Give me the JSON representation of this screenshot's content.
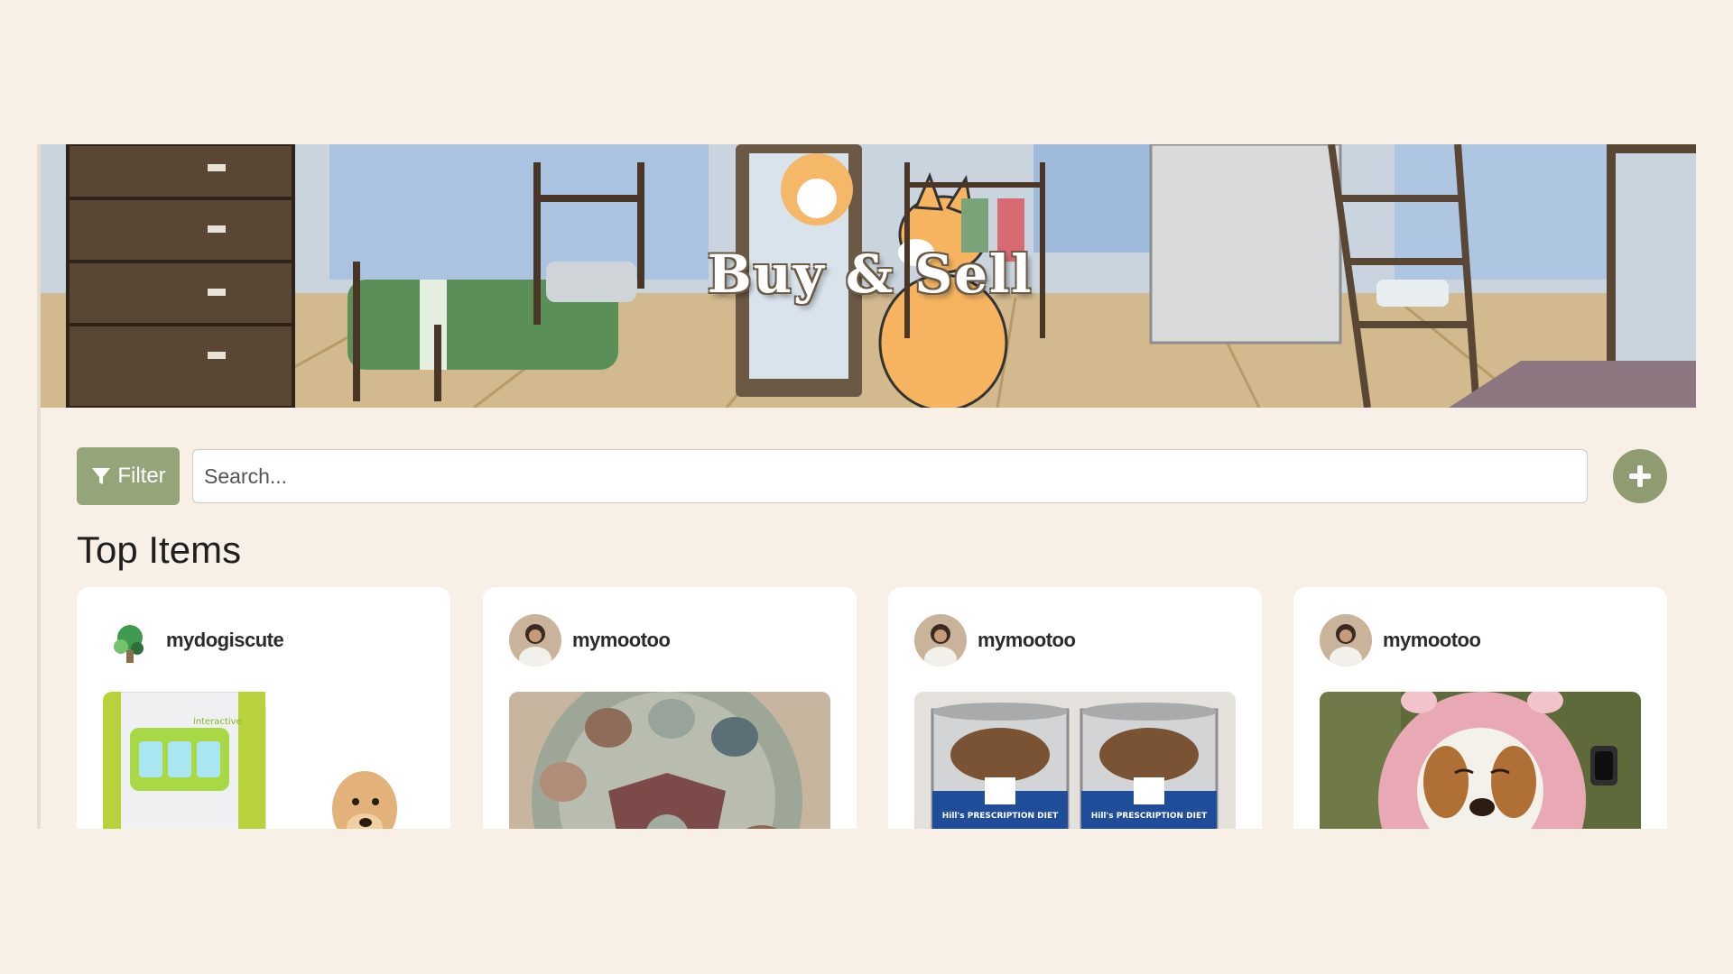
{
  "banner": {
    "title": "Buy & Sell"
  },
  "toolbar": {
    "filter_label": "Filter",
    "search_placeholder": "Search...",
    "search_value": "",
    "add_icon": "plus-circle-icon"
  },
  "section": {
    "title": "Top Items"
  },
  "items": [
    {
      "username": "mydogiscute",
      "image": "interactive-dog-toy-with-labrador",
      "image_text": "interactive"
    },
    {
      "username": "mymootoo",
      "image": "puzzle-feeder-bowl"
    },
    {
      "username": "mymootoo",
      "image": "hills-prescription-diet-cans",
      "image_text": "Hill's PRESCRIPTION DIET"
    },
    {
      "username": "mymootoo",
      "image": "beagle-in-pink-hoodie"
    }
  ],
  "colors": {
    "background": "#f8f0e6",
    "accent": "#96a47a",
    "card": "#ffffff"
  }
}
